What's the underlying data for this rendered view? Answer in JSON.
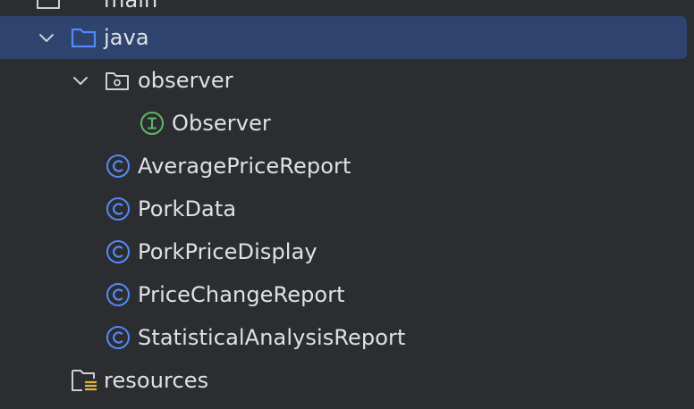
{
  "tree": {
    "items": [
      {
        "label": "main",
        "icon": "folder-icon"
      },
      {
        "label": "java",
        "icon": "source-root-folder-icon",
        "expanded": true,
        "selected": true
      },
      {
        "label": "observer",
        "icon": "package-icon",
        "expanded": true
      },
      {
        "label": "Observer",
        "icon": "interface-icon"
      },
      {
        "label": "AveragePriceReport",
        "icon": "class-icon"
      },
      {
        "label": "PorkData",
        "icon": "class-icon"
      },
      {
        "label": "PorkPriceDisplay",
        "icon": "class-icon"
      },
      {
        "label": "PriceChangeReport",
        "icon": "class-icon"
      },
      {
        "label": "StatisticalAnalysisReport",
        "icon": "class-icon"
      },
      {
        "label": "resources",
        "icon": "resources-folder-icon"
      }
    ]
  },
  "colors": {
    "background": "#2b2d30",
    "selection": "#2e436e",
    "text": "#dfe1e5",
    "class_icon": "#548af7",
    "interface_icon": "#5fb865",
    "resources_accent": "#e0b640"
  }
}
